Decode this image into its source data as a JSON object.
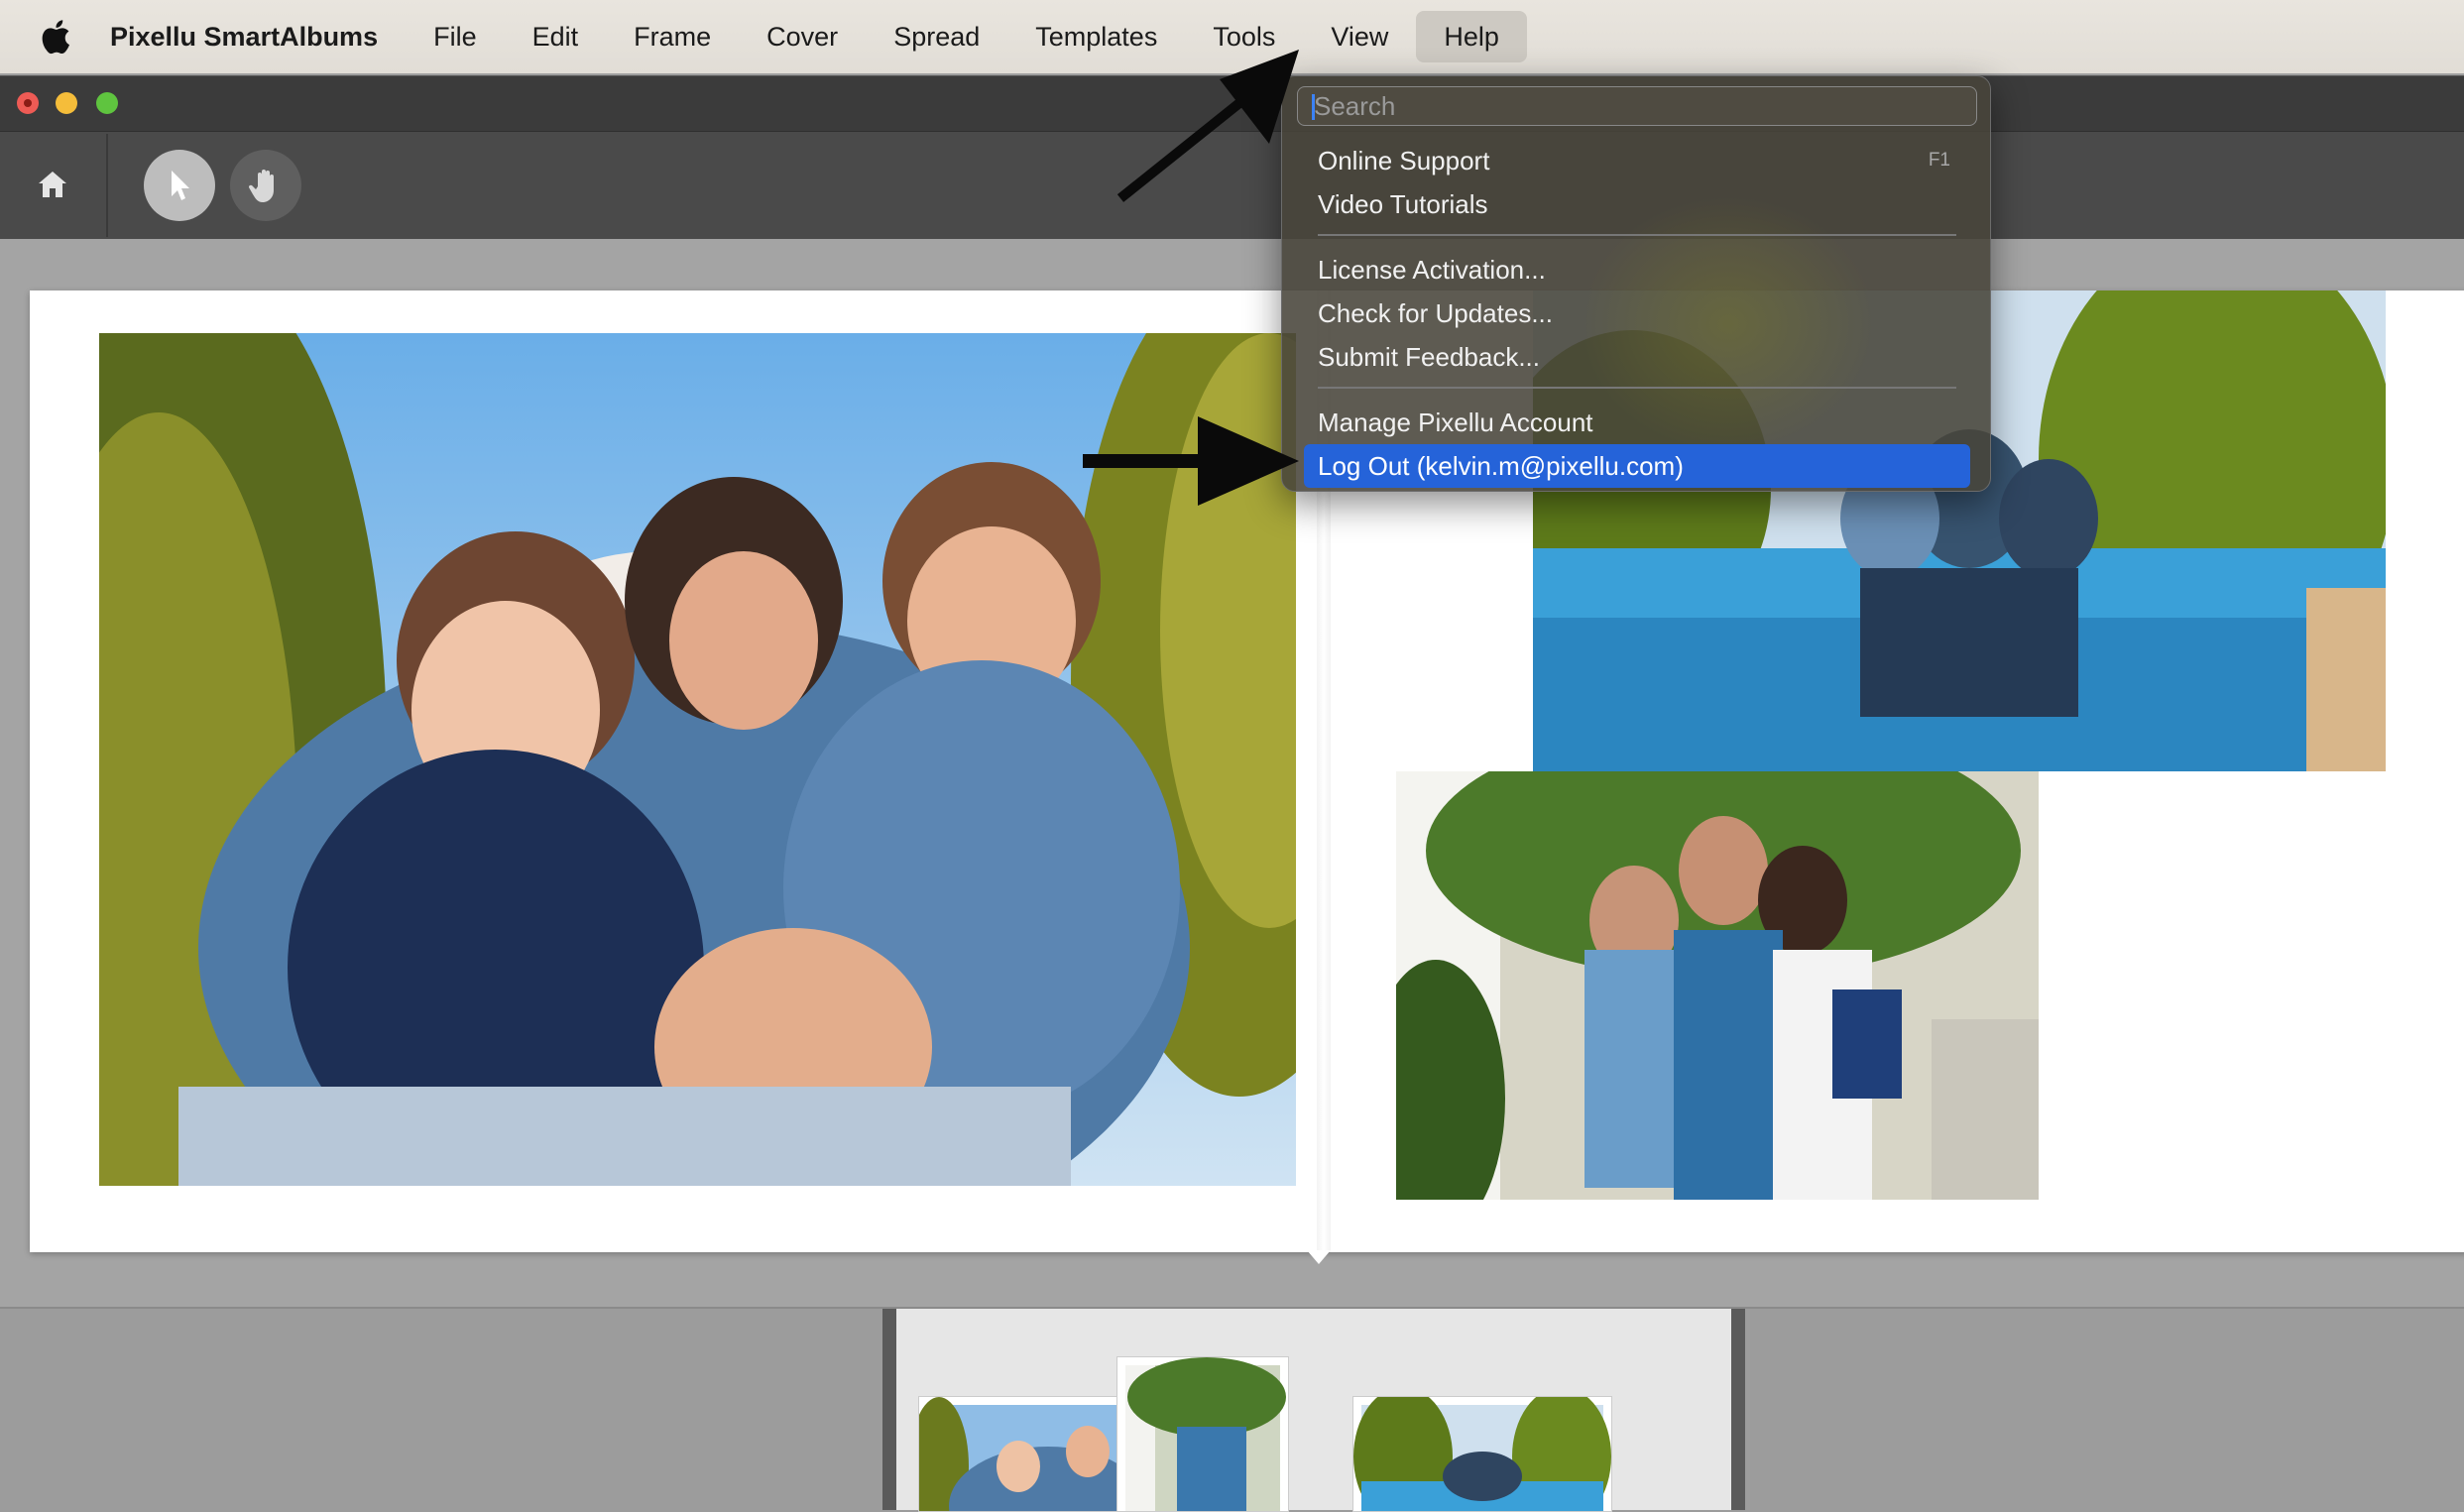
{
  "menubar": {
    "app_name": "Pixellu SmartAlbums",
    "items": [
      "File",
      "Edit",
      "Frame",
      "Cover",
      "Spread",
      "Templates",
      "Tools",
      "View",
      "Help"
    ],
    "open_menu": "Help"
  },
  "help_menu": {
    "search_placeholder": "Search",
    "groups": [
      [
        {
          "label": "Online Support",
          "shortcut": "F1"
        },
        {
          "label": "Video Tutorials"
        }
      ],
      [
        {
          "label": "License Activation..."
        },
        {
          "label": "Check for Updates..."
        },
        {
          "label": "Submit Feedback..."
        }
      ],
      [
        {
          "label": "Manage Pixellu Account"
        },
        {
          "label": "Log Out (kelvin.m@pixellu.com)",
          "highlighted": true
        }
      ]
    ]
  },
  "toolbar": {
    "tools": [
      "home-icon",
      "select-arrow-icon",
      "hand-pan-icon"
    ],
    "active_tool": "select-arrow-icon"
  },
  "colors": {
    "menu_highlight": "#2563d9",
    "window_chrome": "#4a4a4a",
    "workspace": "#a4a4a4"
  }
}
